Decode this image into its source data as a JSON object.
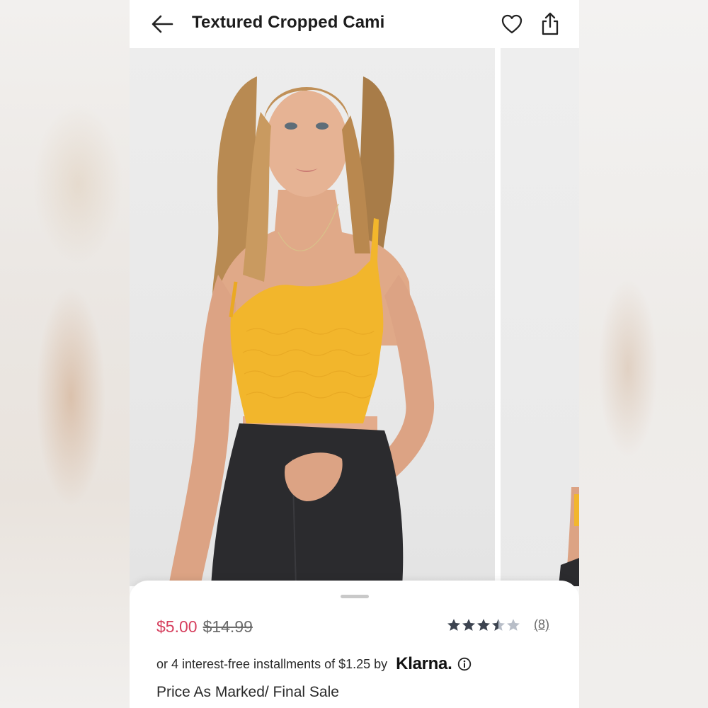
{
  "header": {
    "title": "Textured Cropped Cami",
    "back_icon": "arrow-left-icon",
    "favorite_icon": "heart-outline-icon",
    "share_icon": "share-icon"
  },
  "product": {
    "sale_price": "$5.00",
    "original_price": "$14.99",
    "rating": 3.5,
    "rating_max": 5,
    "review_count": "(8)",
    "installments_text": "or 4 interest-free installments of $1.25 by",
    "installment_provider": "Klarna.",
    "final_sale_note": "Price As Marked/ Final Sale"
  },
  "colors": {
    "sale_price": "#d6405e",
    "star_filled": "#3d4450",
    "star_empty": "#b8bec8",
    "top_color": "#f2b62c"
  }
}
